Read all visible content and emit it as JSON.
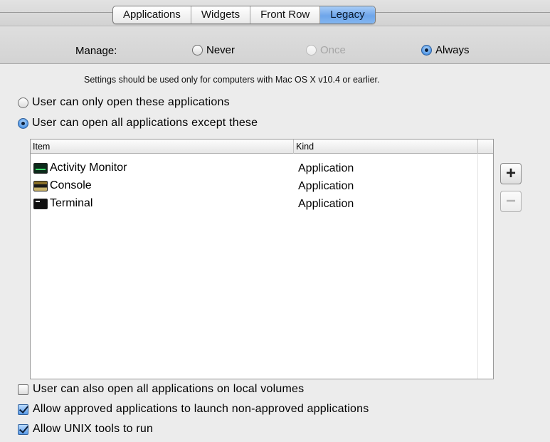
{
  "tabs": [
    {
      "label": "Applications",
      "active": false
    },
    {
      "label": "Widgets",
      "active": false
    },
    {
      "label": "Front Row",
      "active": false
    },
    {
      "label": "Legacy",
      "active": true
    }
  ],
  "manage": {
    "label": "Manage:",
    "options": [
      {
        "label": "Never",
        "selected": false,
        "enabled": true
      },
      {
        "label": "Once",
        "selected": false,
        "enabled": false
      },
      {
        "label": "Always",
        "selected": true,
        "enabled": true
      }
    ]
  },
  "note": "Settings should be used only for computers with Mac OS X v10.4 or earlier.",
  "mode_options": [
    {
      "label": "User can only open these applications",
      "selected": false
    },
    {
      "label": "User can open all applications except these",
      "selected": true
    }
  ],
  "table": {
    "columns": [
      "Item",
      "Kind"
    ],
    "rows": [
      {
        "name": "Activity Monitor",
        "kind": "Application",
        "icon": "activity-monitor-icon"
      },
      {
        "name": "Console",
        "kind": "Application",
        "icon": "console-icon"
      },
      {
        "name": "Terminal",
        "kind": "Application",
        "icon": "terminal-icon"
      }
    ]
  },
  "buttons": {
    "add": "+",
    "remove": "−"
  },
  "checkboxes": [
    {
      "label": "User can also open all applications on local volumes",
      "checked": false
    },
    {
      "label": "Allow approved applications to launch non-approved applications",
      "checked": true
    },
    {
      "label": "Allow UNIX tools to run",
      "checked": true
    }
  ],
  "colors": {
    "accent": "#6ea5ea",
    "background": "#ececec"
  }
}
